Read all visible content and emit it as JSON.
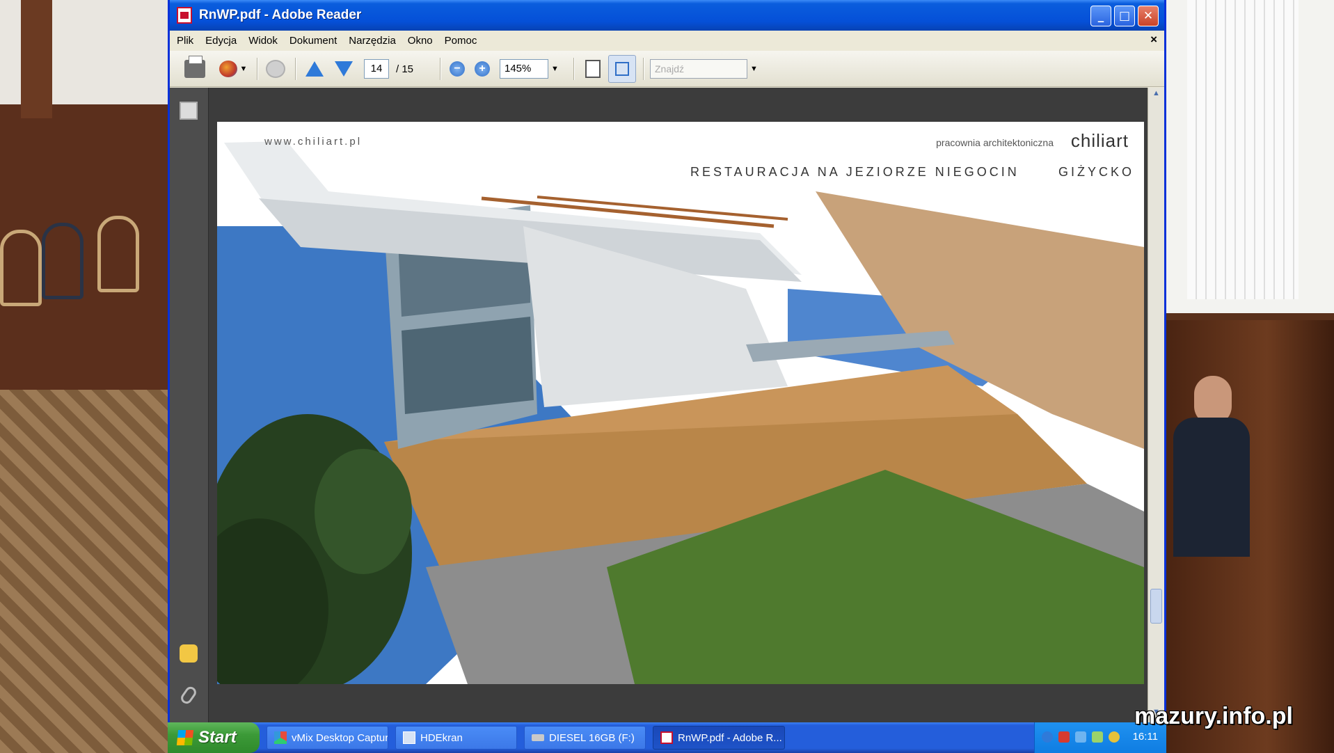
{
  "window": {
    "title": "RnWP.pdf - Adobe Reader",
    "controls": {
      "minimize": "_",
      "maximize": "□",
      "close": "✕"
    }
  },
  "menu": {
    "items": [
      "Plik",
      "Edycja",
      "Widok",
      "Dokument",
      "Narzędzia",
      "Okno",
      "Pomoc"
    ],
    "doc_close": "×"
  },
  "toolbar": {
    "current_page": "14",
    "page_separator": "/ 15",
    "zoom_level": "145%",
    "zoom_out_symbol": "−",
    "zoom_in_symbol": "+",
    "find_placeholder": "Znajdź",
    "icons": [
      "printer-icon",
      "organizer-icon",
      "collaborate-icon",
      "previous-page-icon",
      "next-page-icon",
      "zoom-out-icon",
      "zoom-in-icon",
      "fit-page-icon",
      "full-screen-icon"
    ]
  },
  "nav_pane": {
    "icons": [
      "pages-icon",
      "comments-icon",
      "attachments-icon"
    ]
  },
  "document": {
    "site_url": "www.chiliart.pl",
    "studio_label": "pracownia architektoniczna",
    "brand": "chiliart",
    "headline": "RESTAURACJA NA JEZIORZE NIEGOCIN",
    "city": "GIŻYCKO"
  },
  "taskbar": {
    "start_label": "Start",
    "tasks": [
      {
        "label": "vMix Desktop Captur...",
        "active": false
      },
      {
        "label": "HDEkran",
        "active": false
      },
      {
        "label": "DIESEL 16GB (F:)",
        "active": false
      },
      {
        "label": "RnWP.pdf - Adobe R...",
        "active": true
      }
    ],
    "clock": "16:11"
  },
  "overlay": {
    "watermark": "mazury.info.pl"
  },
  "colors": {
    "titlebar": "#0550d8",
    "taskbar": "#245edb",
    "start_button": "#3c9a38",
    "viewport": "#3c3c3c"
  }
}
